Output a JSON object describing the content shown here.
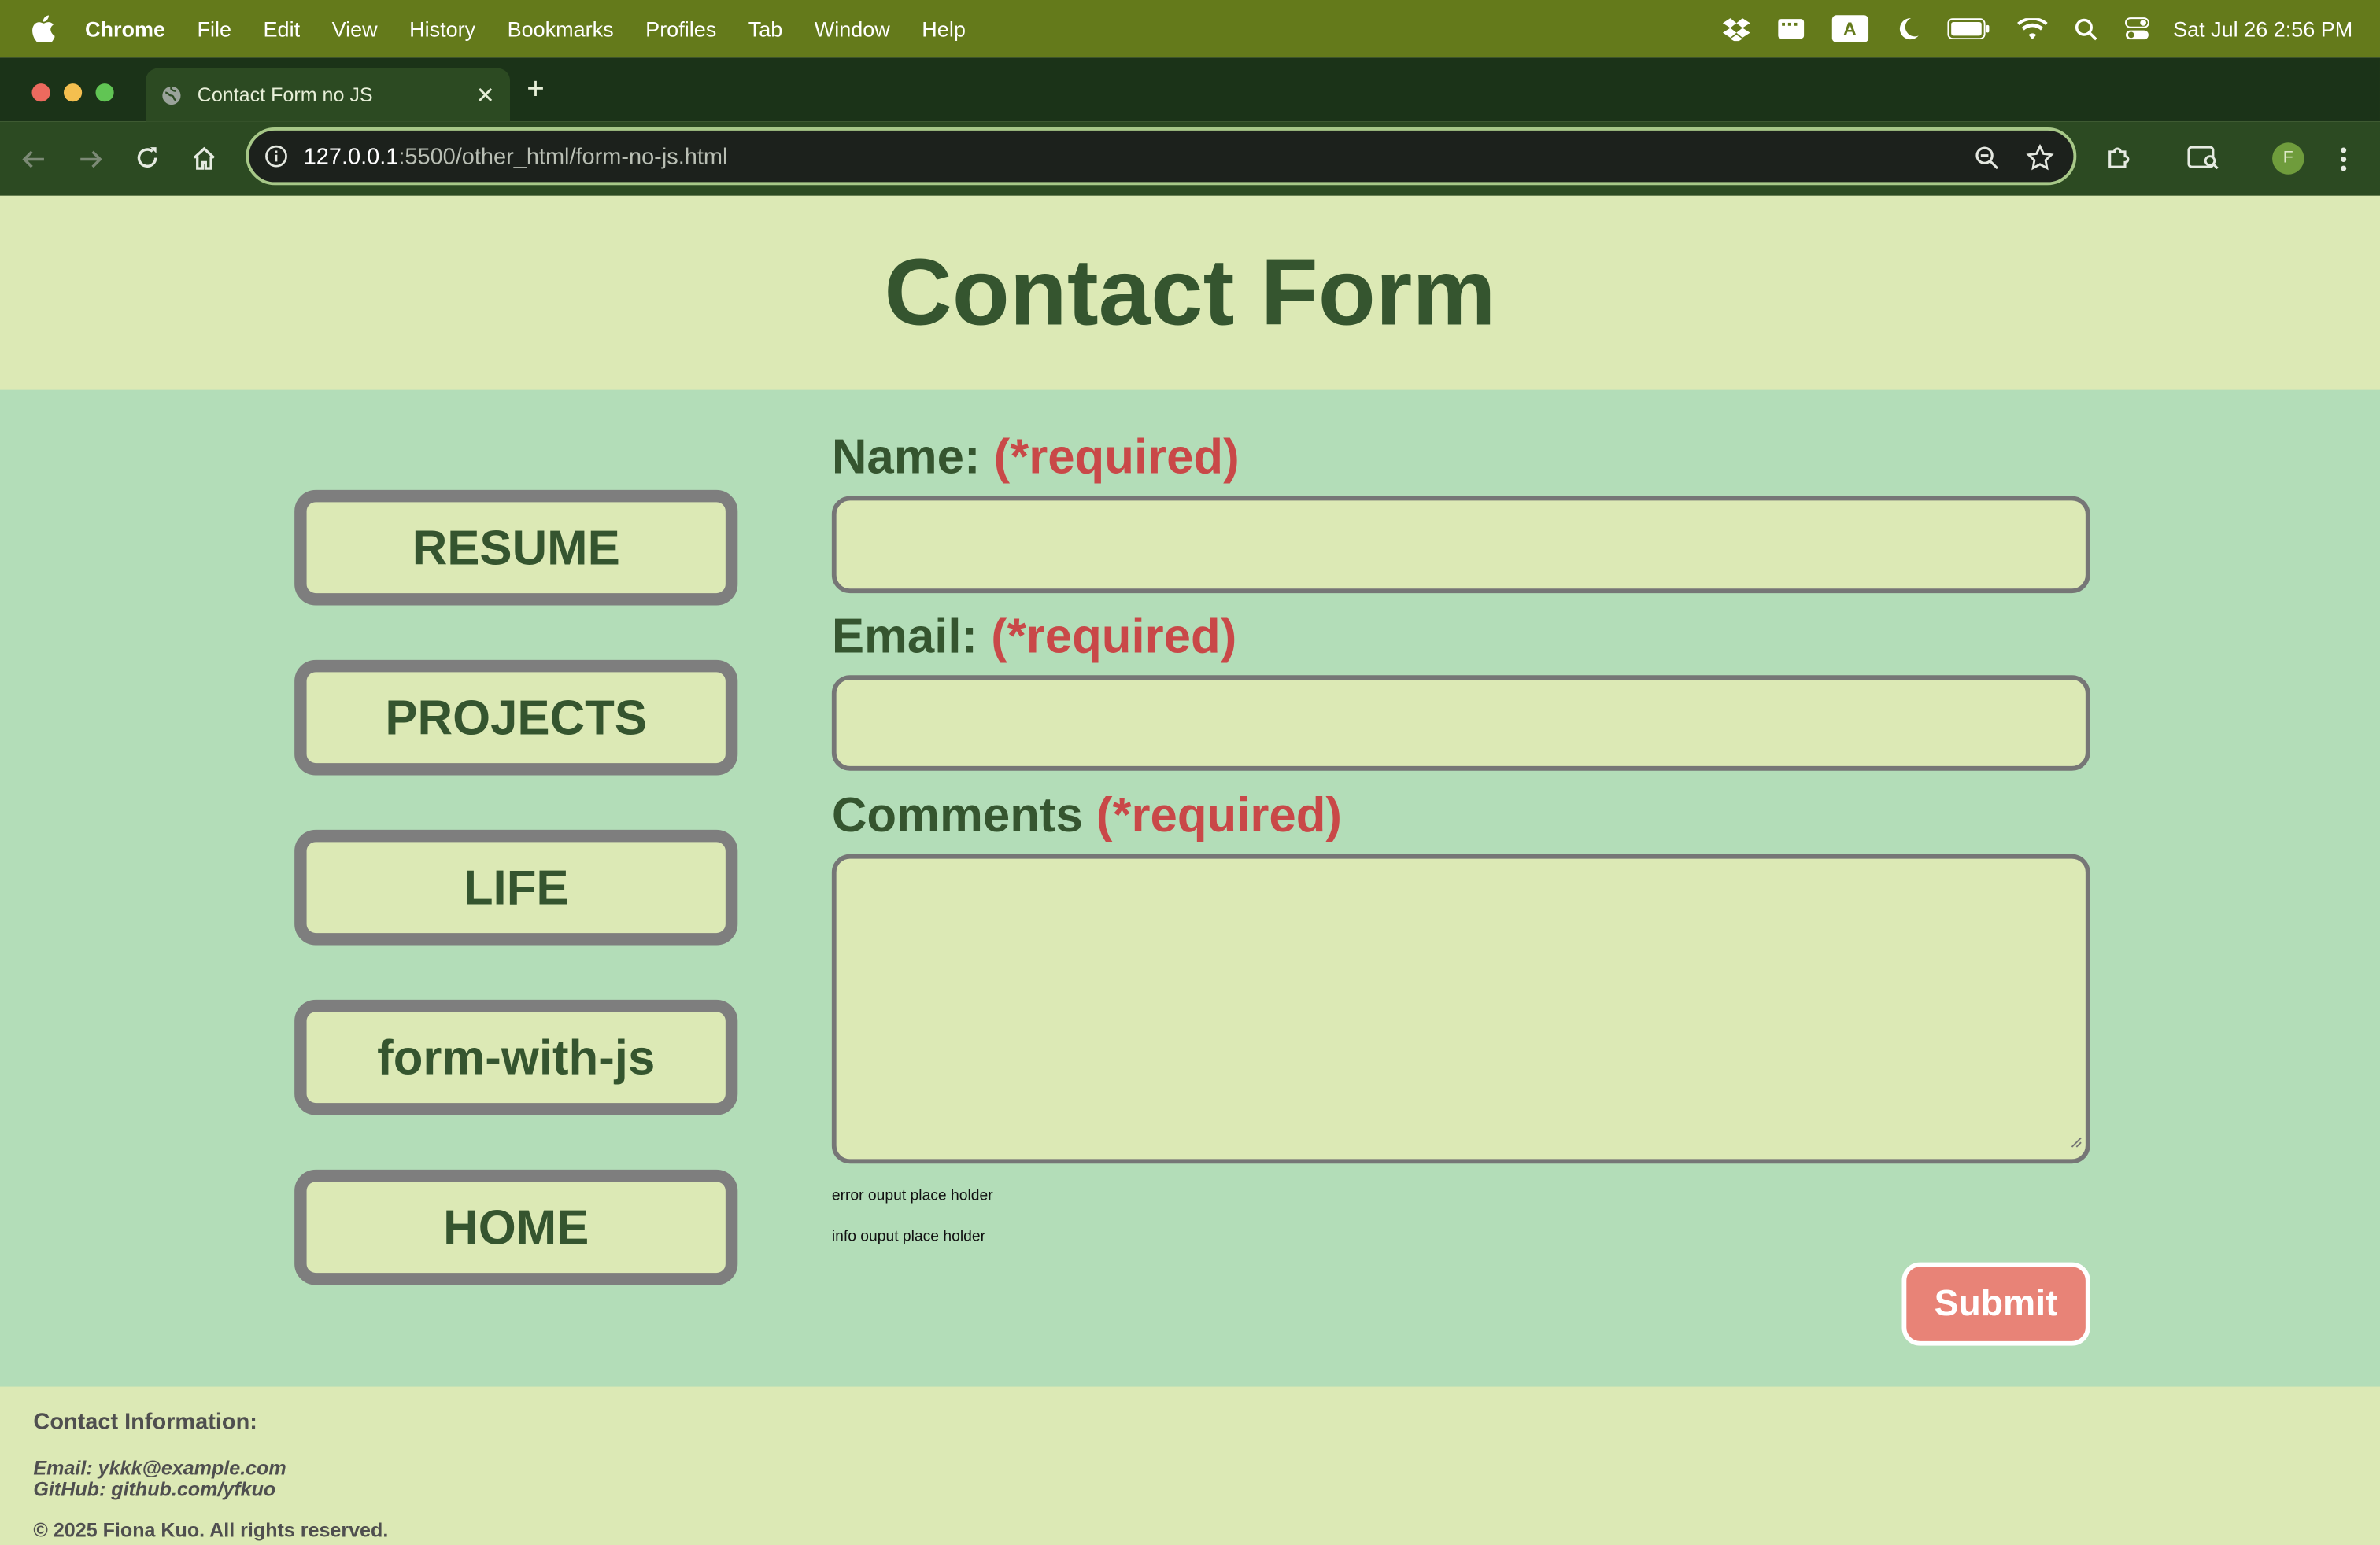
{
  "menubar": {
    "app_name": "Chrome",
    "items": [
      "File",
      "Edit",
      "View",
      "History",
      "Bookmarks",
      "Profiles",
      "Tab",
      "Window",
      "Help"
    ],
    "input_badge": "A",
    "clock": "Sat Jul 26  2:56 PM"
  },
  "browser": {
    "tab_title": "Contact Form no JS",
    "url_host": "127.0.0.1",
    "url_rest": ":5500/other_html/form-no-js.html",
    "profile_initial": "F"
  },
  "page": {
    "title": "Contact Form",
    "nav": [
      "RESUME",
      "PROJECTS",
      "LIFE",
      "form-with-js",
      "HOME"
    ],
    "form": {
      "name_label": "Name:",
      "email_label": "Email:",
      "comments_label": "Comments",
      "required_text": "(*required)",
      "name_value": "",
      "email_value": "",
      "comments_value": "",
      "error_output": "error ouput place holder",
      "info_output": "info ouput place holder",
      "submit_label": "Submit"
    },
    "footer": {
      "heading": "Contact Information:",
      "email": "Email: ykkk@example.com",
      "github": "GitHub: github.com/yfkuo",
      "copyright": "© 2025 Fiona Kuo. All rights reserved."
    }
  },
  "colors": {
    "menubar": "#647a1b",
    "header_bg": "#dce9b5",
    "main_bg": "#b3ddb8",
    "title": "#35552f",
    "required": "#c94848",
    "submit": "#e88377"
  }
}
